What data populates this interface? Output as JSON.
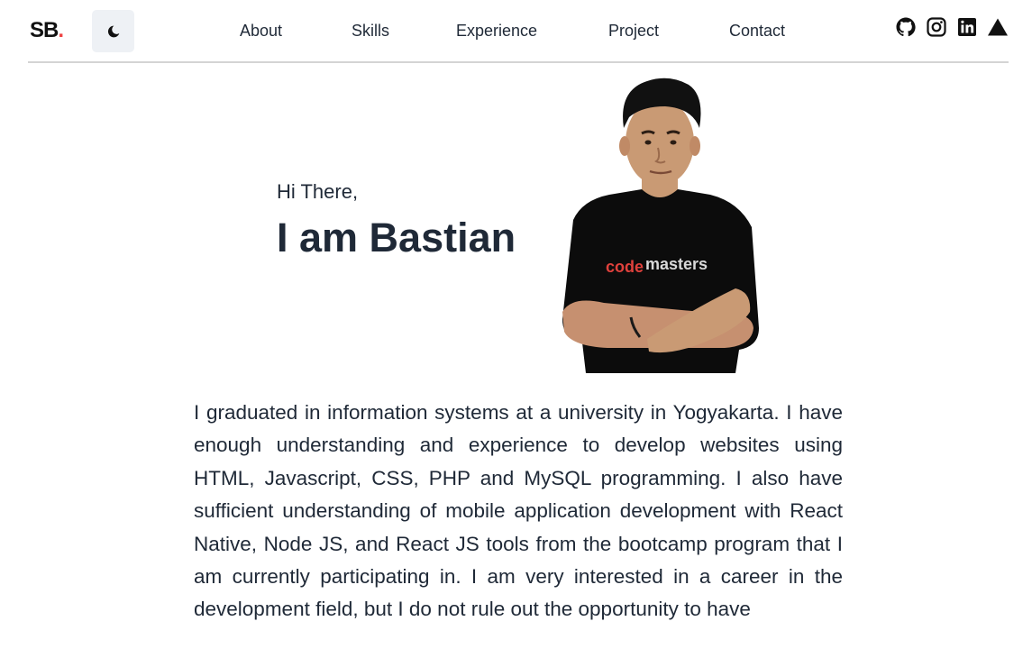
{
  "nav": {
    "logo_text": "SB",
    "logo_dot": ".",
    "theme_toggle_icon": "moon-icon",
    "links": [
      {
        "label": "About"
      },
      {
        "label": "Skills"
      },
      {
        "label": "Experience"
      },
      {
        "label": "Project"
      },
      {
        "label": "Contact"
      }
    ],
    "social_icons": [
      "github-icon",
      "instagram-icon",
      "linkedin-icon",
      "vercel-icon"
    ]
  },
  "hero": {
    "greeting": "Hi There,",
    "name": "I am Bastian",
    "shirt_text_code": "code",
    "shirt_text_masters": "masters"
  },
  "about": {
    "bio": "I graduated in information systems at a university in Yogyakarta. I have enough understanding and experience to develop websites using HTML, Javascript, CSS, PHP and MySQL programming. I also have sufficient understanding of mobile application development with React Native, Node JS, and React JS tools from the bootcamp program that I am currently participating in. I am very interested in a career in the development field, but I do not rule out the opportunity to have"
  },
  "colors": {
    "accent": "#ef4444",
    "text": "#1f2937",
    "toggle_bg": "#eef1f5",
    "divider": "#d4d4d4"
  }
}
